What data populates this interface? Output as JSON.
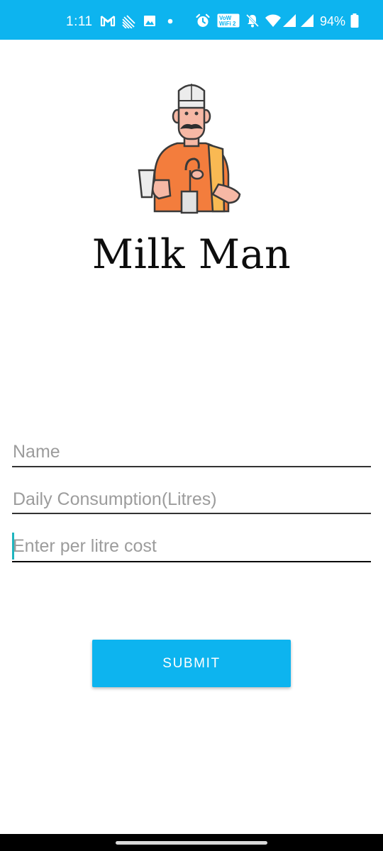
{
  "status_bar": {
    "time": "1:11",
    "battery_text": "94%",
    "background": "#0db4ef",
    "icons": [
      "gmail-icon",
      "cast-icon",
      "image-icon",
      "dot-icon",
      "alarm-icon",
      "vowifi-icon",
      "mute-icon",
      "wifi-icon",
      "signal-icon",
      "signal-icon-2",
      "battery-icon"
    ],
    "vowifi_line1": "VoW",
    "vowifi_line2": "WiFi 2"
  },
  "app": {
    "title": "Milk Man",
    "logo_icon": "milkman-illustration-icon"
  },
  "form": {
    "name_placeholder": "Name",
    "daily_placeholder": "Daily Consumption(Litres)",
    "cost_placeholder": "Enter per litre cost",
    "submit_label": "SUBMIT",
    "accent": "#0db4ef",
    "cursor_color": "#1fb5bf"
  }
}
